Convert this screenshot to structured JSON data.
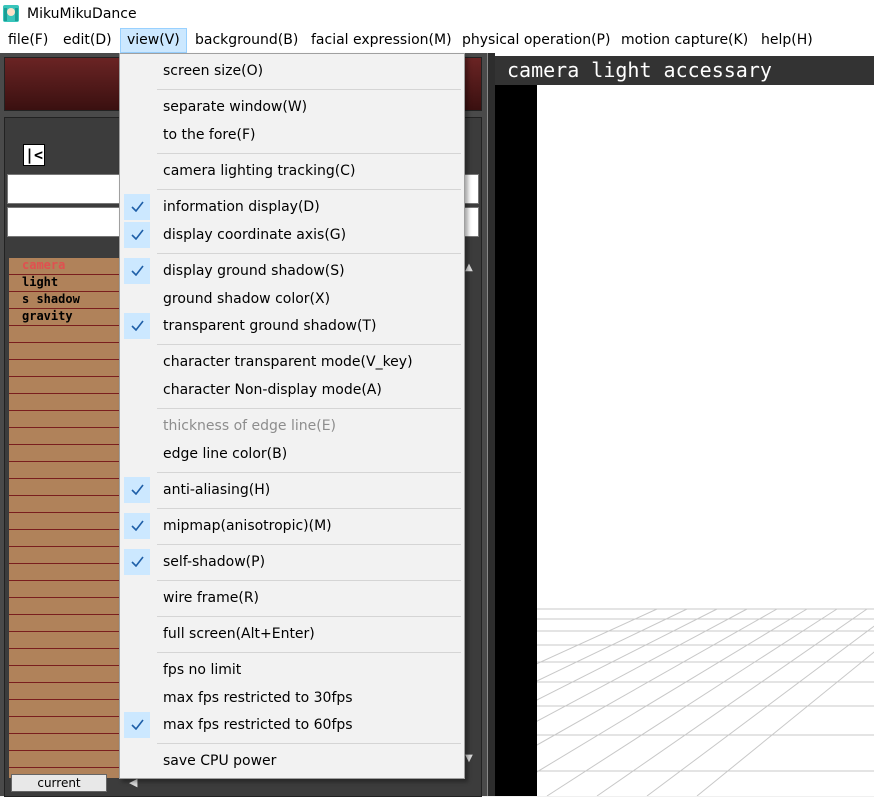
{
  "window": {
    "title": "MikuMikuDance",
    "icon": "miku-app-icon"
  },
  "menubar": {
    "items": [
      {
        "label": "file(F)"
      },
      {
        "label": "edit(D)"
      },
      {
        "label": "view(V)"
      },
      {
        "label": "background(B)"
      },
      {
        "label": "facial expression(M)"
      },
      {
        "label": "physical operation(P)"
      },
      {
        "label": "motion capture(K)"
      },
      {
        "label": "help(H)"
      }
    ]
  },
  "view_menu": {
    "items": [
      {
        "label": "screen size(O)",
        "checked": false,
        "enabled": true
      },
      {
        "label": "separate window(W)",
        "checked": false,
        "enabled": true
      },
      {
        "label": "to the fore(F)",
        "checked": false,
        "enabled": true
      },
      {
        "label": "camera  lighting tracking(C)",
        "checked": false,
        "enabled": true
      },
      {
        "label": "information display(D)",
        "checked": true,
        "enabled": true
      },
      {
        "label": "display coordinate axis(G)",
        "checked": true,
        "enabled": true
      },
      {
        "label": "display ground shadow(S)",
        "checked": true,
        "enabled": true
      },
      {
        "label": "ground shadow color(X)",
        "checked": false,
        "enabled": true
      },
      {
        "label": "transparent ground shadow(T)",
        "checked": true,
        "enabled": true
      },
      {
        "label": "character transparent mode(V_key)",
        "checked": false,
        "enabled": true
      },
      {
        "label": "character Non-display mode(A)",
        "checked": false,
        "enabled": true
      },
      {
        "label": "thickness of edge line(E)",
        "checked": false,
        "enabled": false
      },
      {
        "label": "edge line color(B)",
        "checked": false,
        "enabled": true
      },
      {
        "label": "anti-aliasing(H)",
        "checked": true,
        "enabled": true
      },
      {
        "label": "mipmap(anisotropic)(M)",
        "checked": true,
        "enabled": true
      },
      {
        "label": "self-shadow(P)",
        "checked": true,
        "enabled": true
      },
      {
        "label": "wire frame(R)",
        "checked": false,
        "enabled": true
      },
      {
        "label": "full screen(Alt+Enter)",
        "checked": false,
        "enabled": true
      },
      {
        "label": "fps no limit",
        "checked": false,
        "enabled": true
      },
      {
        "label": "max fps restricted to 30fps",
        "checked": false,
        "enabled": true
      },
      {
        "label": "max fps restricted to 60fps",
        "checked": true,
        "enabled": true
      },
      {
        "label": "save CPU power",
        "checked": false,
        "enabled": true
      }
    ]
  },
  "left_panel": {
    "first_frame_button": "|<",
    "tracks": [
      "camera",
      "light",
      "s shadow",
      "gravity"
    ],
    "current_button": "current"
  },
  "viewport": {
    "tab_title": "camera light accessary"
  },
  "colors": {
    "menu_highlight": "#cce8ff",
    "check_color": "#1e5fa8",
    "track_active": "#e05050",
    "track_bg": "#b0825a"
  }
}
